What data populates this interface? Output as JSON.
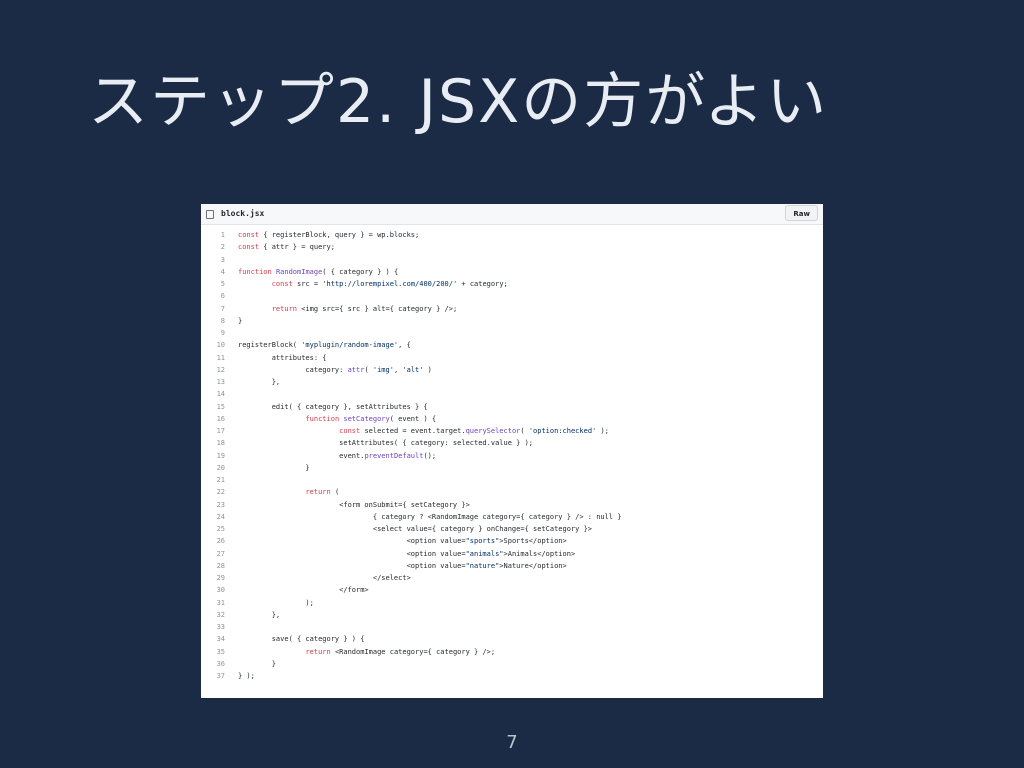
{
  "slide": {
    "title": "ステップ2. JSXの方がよい",
    "page_number": "7"
  },
  "file": {
    "name": "block.jsx",
    "raw_label": "Raw",
    "lines": [
      {
        "n": "1",
        "code": "const { registerBlock, query } = wp.blocks;"
      },
      {
        "n": "2",
        "code": "const { attr } = query;"
      },
      {
        "n": "3",
        "code": ""
      },
      {
        "n": "4",
        "code": "function RandomImage( { category } ) {"
      },
      {
        "n": "5",
        "code": "        const src = 'http://lorempixel.com/400/200/' + category;"
      },
      {
        "n": "6",
        "code": ""
      },
      {
        "n": "7",
        "code": "        return <img src={ src } alt={ category } />;"
      },
      {
        "n": "8",
        "code": "}"
      },
      {
        "n": "9",
        "code": ""
      },
      {
        "n": "10",
        "code": "registerBlock( 'myplugin/random-image', {"
      },
      {
        "n": "11",
        "code": "        attributes: {"
      },
      {
        "n": "12",
        "code": "                category: attr( 'img', 'alt' )"
      },
      {
        "n": "13",
        "code": "        },"
      },
      {
        "n": "14",
        "code": ""
      },
      {
        "n": "15",
        "code": "        edit( { category }, setAttributes } {"
      },
      {
        "n": "16",
        "code": "                function setCategory( event ) {"
      },
      {
        "n": "17",
        "code": "                        const selected = event.target.querySelector( 'option:checked' );"
      },
      {
        "n": "18",
        "code": "                        setAttributes( { category: selected.value } );"
      },
      {
        "n": "19",
        "code": "                        event.preventDefault();"
      },
      {
        "n": "20",
        "code": "                }"
      },
      {
        "n": "21",
        "code": ""
      },
      {
        "n": "22",
        "code": "                return ("
      },
      {
        "n": "23",
        "code": "                        <form onSubmit={ setCategory }>"
      },
      {
        "n": "24",
        "code": "                                { category ? <RandomImage category={ category } /> : null }"
      },
      {
        "n": "25",
        "code": "                                <select value={ category } onChange={ setCategory }>"
      },
      {
        "n": "26",
        "code": "                                        <option value=\"sports\">Sports</option>"
      },
      {
        "n": "27",
        "code": "                                        <option value=\"animals\">Animals</option>"
      },
      {
        "n": "28",
        "code": "                                        <option value=\"nature\">Nature</option>"
      },
      {
        "n": "29",
        "code": "                                </select>"
      },
      {
        "n": "30",
        "code": "                        </form>"
      },
      {
        "n": "31",
        "code": "                );"
      },
      {
        "n": "32",
        "code": "        },"
      },
      {
        "n": "33",
        "code": ""
      },
      {
        "n": "34",
        "code": "        save( { category } ) {"
      },
      {
        "n": "35",
        "code": "                return <RandomImage category={ category } />;"
      },
      {
        "n": "36",
        "code": "        }"
      },
      {
        "n": "37",
        "code": "} );"
      }
    ]
  },
  "colors": {
    "background": "#1b2a45",
    "keyword": "#d73a49",
    "function": "#6f42c1",
    "string": "#032f62"
  }
}
